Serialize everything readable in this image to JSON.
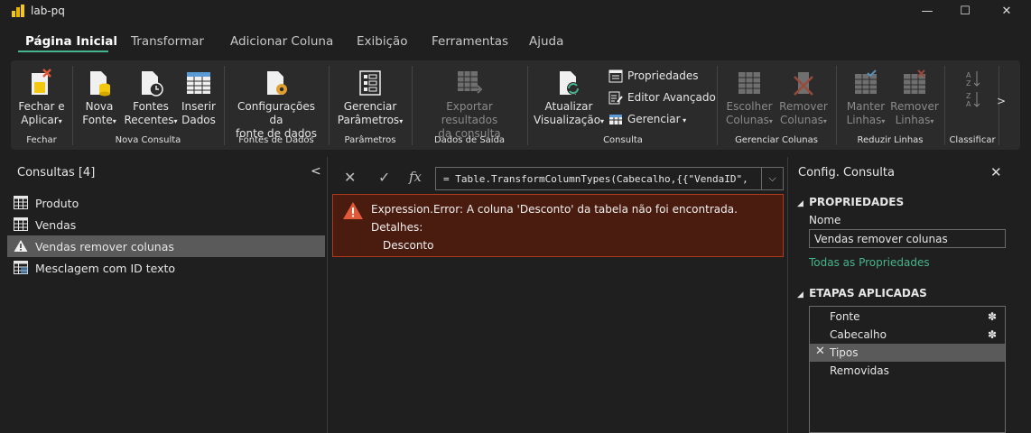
{
  "window": {
    "title": "lab-pq",
    "minimize": "—",
    "maximize": "☐",
    "close": "✕"
  },
  "tabs": [
    "Página Inicial",
    "Transformar",
    "Adicionar Coluna",
    "Exibição",
    "Ferramentas",
    "Ajuda"
  ],
  "ribbon": {
    "fechar": {
      "line1": "Fechar e",
      "line2": "Aplicar",
      "group": "Fechar"
    },
    "nova_fonte": {
      "line1": "Nova",
      "line2": "Fonte"
    },
    "fontes_recentes": {
      "line1": "Fontes",
      "line2": "Recentes"
    },
    "inserir_dados": {
      "line1": "Inserir",
      "line2": "Dados"
    },
    "nova_consulta_group": "Nova Consulta",
    "config_fonte": {
      "line1": "Configurações da",
      "line2": "fonte de dados"
    },
    "fontes_group": "Fontes de Dados",
    "gerenciar_param": {
      "line1": "Gerenciar",
      "line2": "Parâmetros"
    },
    "param_group": "Parâmetros",
    "exportar": {
      "line1": "Exportar resultados",
      "line2": "da consulta"
    },
    "saida_group": "Dados de Saída",
    "atualizar": {
      "line1": "Atualizar",
      "line2": "Visualização"
    },
    "propriedades": "Propriedades",
    "editor_avancado": "Editor Avançado",
    "gerenciar": "Gerenciar",
    "consulta_group": "Consulta",
    "escolher_colunas": {
      "line1": "Escolher",
      "line2": "Colunas"
    },
    "remover_colunas": {
      "line1": "Remover",
      "line2": "Colunas"
    },
    "gerenciar_colunas_group": "Gerenciar Colunas",
    "manter_linhas": {
      "line1": "Manter",
      "line2": "Linhas"
    },
    "remover_linhas": {
      "line1": "Remover",
      "line2": "Linhas"
    },
    "reduzir_group": "Reduzir Linhas",
    "classificar_group": "Classificar",
    "more": ">"
  },
  "queries": {
    "title": "Consultas [4]",
    "collapse": "<",
    "items": [
      {
        "label": "Produto",
        "icon": "table-icon"
      },
      {
        "label": "Vendas",
        "icon": "table-icon"
      },
      {
        "label": "Vendas remover colunas",
        "icon": "warning-icon"
      },
      {
        "label": "Mesclagem com ID texto",
        "icon": "merge-table-icon"
      }
    ]
  },
  "formula": {
    "cancel": "✕",
    "commit": "✓",
    "fx": "fx",
    "text": "= Table.TransformColumnTypes(Cabecalho,{{\"VendaID\",",
    "expand": "⌵"
  },
  "error": {
    "message": "Expression.Error: A coluna 'Desconto' da tabela não foi encontrada.",
    "details_label": "Detalhes:",
    "details_value": "Desconto"
  },
  "settings": {
    "title": "Config. Consulta",
    "close": "✕",
    "properties_header": "PROPRIEDADES",
    "name_label": "Nome",
    "name_value": "Vendas remover colunas",
    "all_properties": "Todas as Propriedades",
    "steps_header": "ETAPAS APLICADAS",
    "steps": [
      {
        "label": "Fonte",
        "gear": true,
        "selected": false
      },
      {
        "label": "Cabecalho",
        "gear": true,
        "selected": false
      },
      {
        "label": "Tipos",
        "gear": false,
        "selected": true
      },
      {
        "label": "Removidas",
        "gear": false,
        "selected": false
      }
    ]
  },
  "colors": {
    "accent": "#46b48c",
    "error_bg": "#4a1b0f",
    "error_border": "#b03a20",
    "warning": "#e05a3a"
  }
}
